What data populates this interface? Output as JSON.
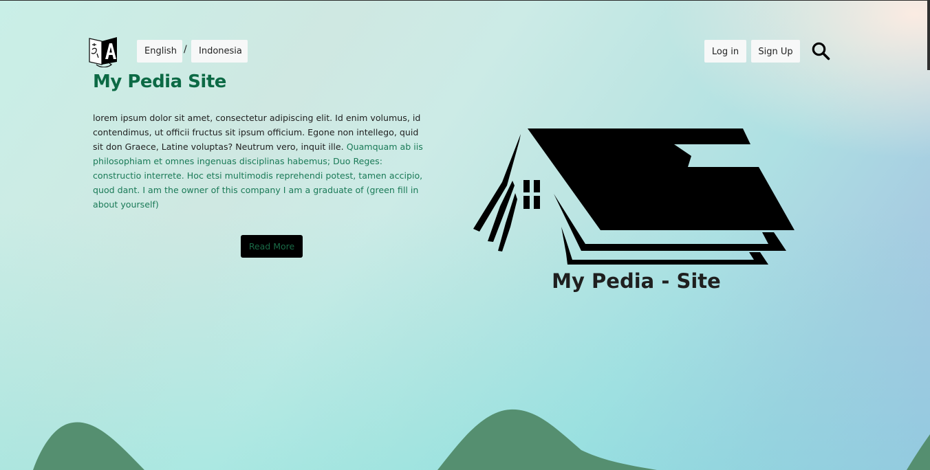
{
  "header": {
    "languages": [
      "English",
      "Indonesia"
    ],
    "separator": "/",
    "login_label": "Log in",
    "signup_label": "Sign Up"
  },
  "hero": {
    "title": "My Pedia Site",
    "intro_plain": "lorem ipsum dolor sit amet, consectetur adipiscing elit. Id enim volumus, id contendimus, ut officii fructus sit ipsum officium. Egone non intellego, quid sit don Graece, Latine voluptas? Neutrum vero, inquit ille. ",
    "intro_green": "Quamquam ab iis philosophiam et omnes ingenuas disciplinas habemus; Duo Reges: constructio interrete. Hoc etsi multimodis reprehendi potest, tamen accipio, quod dant. I am the owner of this company I am a graduate of (green fill in about yourself)",
    "read_more_label": "Read More"
  },
  "logo": {
    "text": "My Pedia - Site"
  },
  "colors": {
    "title_green": "#0c6a45",
    "hill_green": "#558f70",
    "button_black": "#000000"
  },
  "icons": [
    "translate-icon",
    "search-icon",
    "house-logo"
  ]
}
